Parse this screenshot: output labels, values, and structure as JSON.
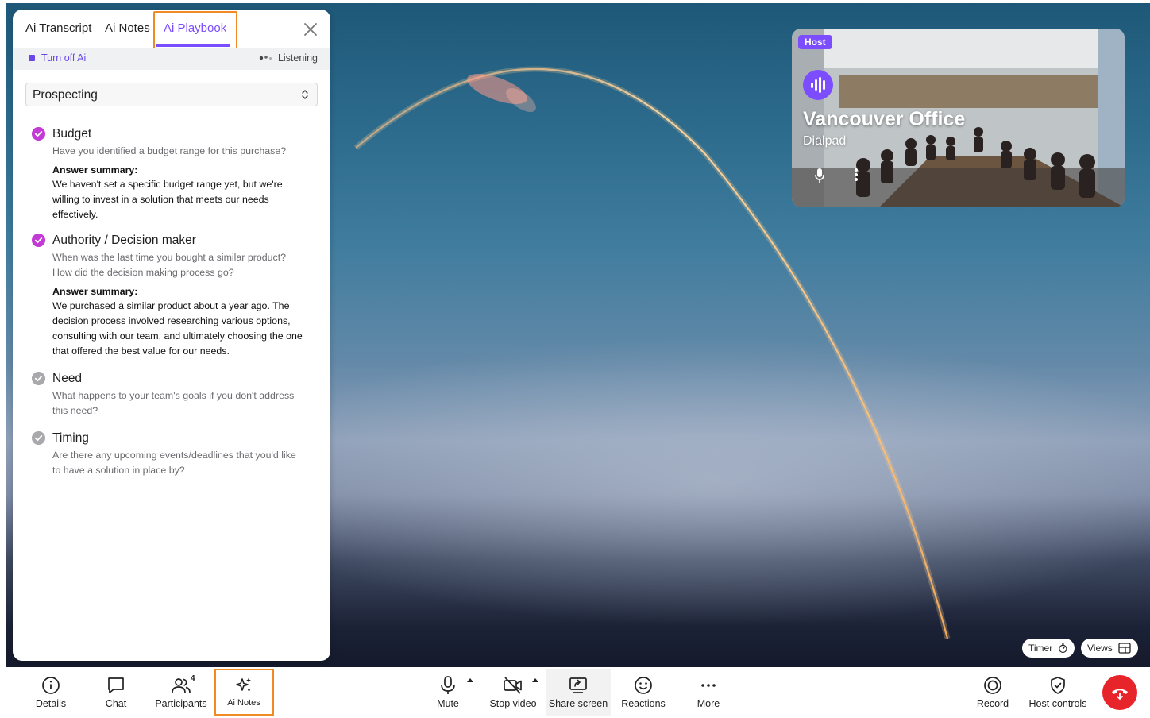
{
  "panel": {
    "tabs": [
      "Ai Transcript",
      "Ai Notes",
      "Ai Playbook"
    ],
    "active_tab": "Ai Playbook",
    "turn_off_label": "Turn off Ai",
    "listening_label": "Listening",
    "playbook_select": "Prospecting",
    "items": [
      {
        "title": "Budget",
        "status": "complete",
        "question": "Have you identified a budget range for this purchase?",
        "answer_label": "Answer summary:",
        "answer": "We haven't set a specific budget range yet, but we're willing to invest in a solution that meets our needs effectively."
      },
      {
        "title": "Authority / Decision maker",
        "status": "complete",
        "question": "When was the last time you bought a similar product? How did the decision making process go?",
        "answer_label": "Answer summary:",
        "answer": "We purchased a similar product about a year ago. The decision process involved researching various options, consulting with our team, and ultimately choosing the one that offered the best value for our needs."
      },
      {
        "title": "Need",
        "status": "pending",
        "question": "What happens to your team's goals if you don't address this need?"
      },
      {
        "title": "Timing",
        "status": "pending",
        "question": "Are there any upcoming events/deadlines that you'd like to have a solution in place by?"
      }
    ]
  },
  "tile": {
    "badge": "Host",
    "title": "Vancouver Office",
    "subtitle": "Dialpad"
  },
  "stage_controls": {
    "timer_label": "Timer",
    "views_label": "Views"
  },
  "toolbar": {
    "details": "Details",
    "chat": "Chat",
    "participants": "Participants",
    "participants_count": "4",
    "ai_notes": "Ai Notes",
    "mute": "Mute",
    "stop_video": "Stop video",
    "share_screen": "Share screen",
    "reactions": "Reactions",
    "more": "More",
    "record": "Record",
    "host_controls": "Host controls"
  },
  "colors": {
    "accent_purple": "#7c4dff",
    "check_complete": "#c43ad6",
    "check_pending": "#a9a9ad",
    "highlight_orange": "#f08a24",
    "end_call_red": "#e8242b"
  }
}
